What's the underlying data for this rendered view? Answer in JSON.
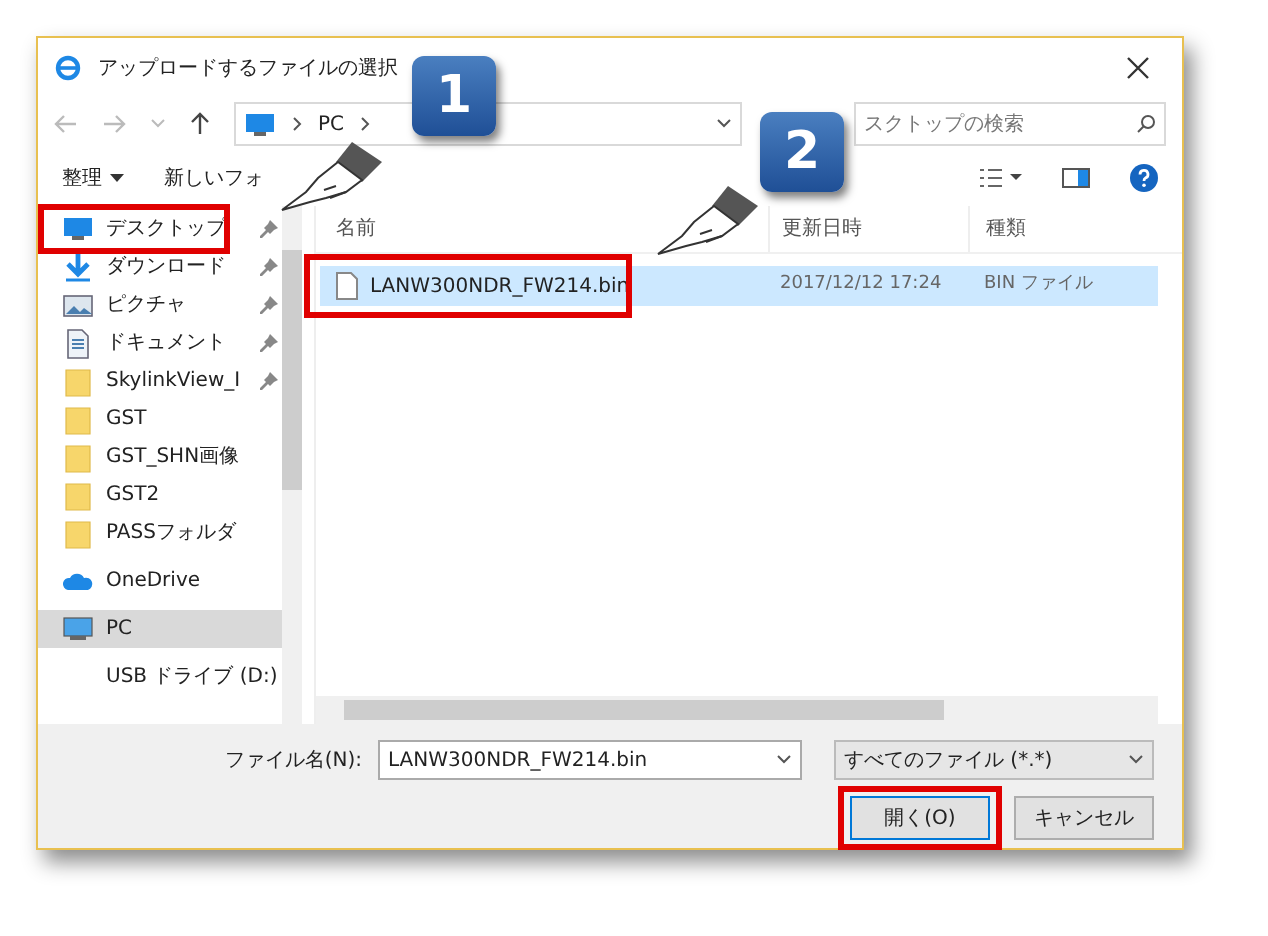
{
  "window": {
    "title": "アップロードするファイルの選択"
  },
  "address": {
    "crumbs": [
      "PC"
    ],
    "search_placeholder": "スクトップの検索"
  },
  "toolbar": {
    "organize": "整理",
    "new_folder": "新しいフォ"
  },
  "sidebar": {
    "items": [
      {
        "kind": "desktop",
        "label": "デスクトップ",
        "pinned": true,
        "selected": false,
        "highlighted": true
      },
      {
        "kind": "download",
        "label": "ダウンロード",
        "pinned": true,
        "selected": false,
        "highlighted": false
      },
      {
        "kind": "picture",
        "label": "ピクチャ",
        "pinned": true,
        "selected": false,
        "highlighted": false
      },
      {
        "kind": "document",
        "label": "ドキュメント",
        "pinned": true,
        "selected": false,
        "highlighted": false
      },
      {
        "kind": "folder",
        "label": "SkylinkView_I",
        "pinned": true,
        "selected": false,
        "highlighted": false
      },
      {
        "kind": "folder",
        "label": "GST",
        "pinned": false,
        "selected": false,
        "highlighted": false
      },
      {
        "kind": "folder",
        "label": "GST_SHN画像",
        "pinned": false,
        "selected": false,
        "highlighted": false
      },
      {
        "kind": "folder",
        "label": "GST2",
        "pinned": false,
        "selected": false,
        "highlighted": false
      },
      {
        "kind": "folder",
        "label": "PASSフォルダ",
        "pinned": false,
        "selected": false,
        "highlighted": false
      },
      {
        "kind": "cloud",
        "label": "OneDrive",
        "pinned": false,
        "selected": false,
        "highlighted": false
      },
      {
        "kind": "pc",
        "label": "PC",
        "pinned": false,
        "selected": true,
        "highlighted": false
      },
      {
        "kind": "drive",
        "label": "USB ドライブ (D:)",
        "pinned": false,
        "selected": false,
        "highlighted": false
      }
    ]
  },
  "file_list": {
    "columns": [
      "名前",
      "更新日時",
      "種類"
    ],
    "rows": [
      {
        "name": "LANW300NDR_FW214.bin",
        "modified": "2017/12/12 17:24",
        "type": "BIN ファイル",
        "selected": true,
        "highlighted": true
      }
    ]
  },
  "footer": {
    "file_name_label": "ファイル名(N):",
    "file_name": "LANW300NDR_FW214.bin",
    "file_type": "すべてのファイル (*.*)",
    "buttons": [
      {
        "label": "開く(O)",
        "highlighted": true
      },
      {
        "label": "キャンセル",
        "highlighted": false
      }
    ]
  },
  "callouts": [
    {
      "label": "1"
    },
    {
      "label": "2"
    }
  ]
}
